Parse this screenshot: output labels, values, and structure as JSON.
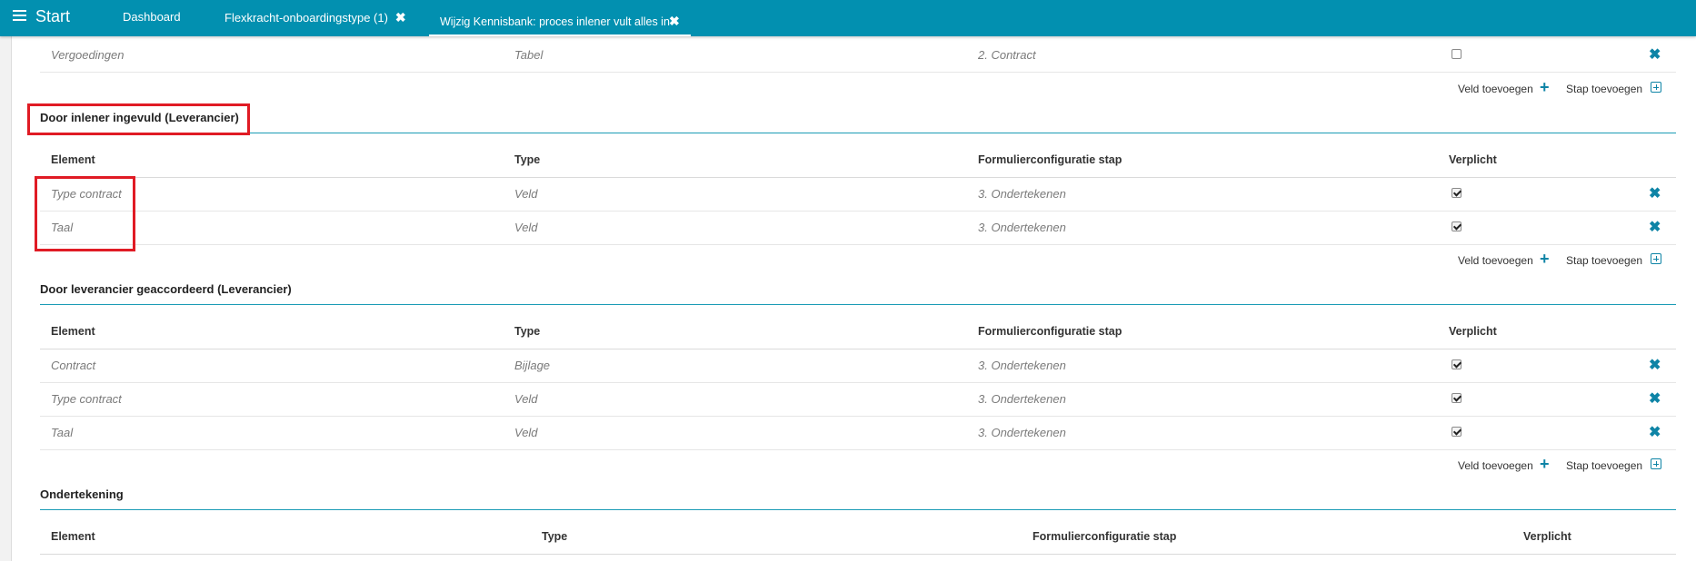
{
  "topbar": {
    "brand": "Start",
    "tabs": [
      {
        "label": "Dashboard"
      },
      {
        "label": "Flexkracht-onboardingstype (1)",
        "close": "✖"
      },
      {
        "label": "Wijzig Kennisbank: proces inlener vult alles in",
        "close": "✖"
      }
    ]
  },
  "columns": {
    "element": "Element",
    "type": "Type",
    "stap": "Formulierconfiguratie stap",
    "verplicht": "Verplicht"
  },
  "actions": {
    "veld_toevoegen": "Veld toevoegen",
    "stap_toevoegen": "Stap toevoegen"
  },
  "top_row": {
    "element": "Vergoedingen",
    "type": "Tabel",
    "stap": "2. Contract",
    "verplicht": false
  },
  "sections": [
    {
      "title": "Door inlener ingevuld (Leverancier)",
      "rows": [
        {
          "element": "Type contract",
          "type": "Veld",
          "stap": "3. Ondertekenen",
          "verplicht": true
        },
        {
          "element": "Taal",
          "type": "Veld",
          "stap": "3. Ondertekenen",
          "verplicht": true
        }
      ]
    },
    {
      "title": "Door leverancier geaccordeerd (Leverancier)",
      "rows": [
        {
          "element": "Contract",
          "type": "Bijlage",
          "stap": "3. Ondertekenen",
          "verplicht": true
        },
        {
          "element": "Type contract",
          "type": "Veld",
          "stap": "3. Ondertekenen",
          "verplicht": true
        },
        {
          "element": "Taal",
          "type": "Veld",
          "stap": "3. Ondertekenen",
          "verplicht": true
        }
      ]
    },
    {
      "title": "Ondertekening",
      "rows": []
    }
  ],
  "colors": {
    "topbar": "#0290b0",
    "accent": "#0e84a6",
    "highlight": "#e01b24"
  }
}
